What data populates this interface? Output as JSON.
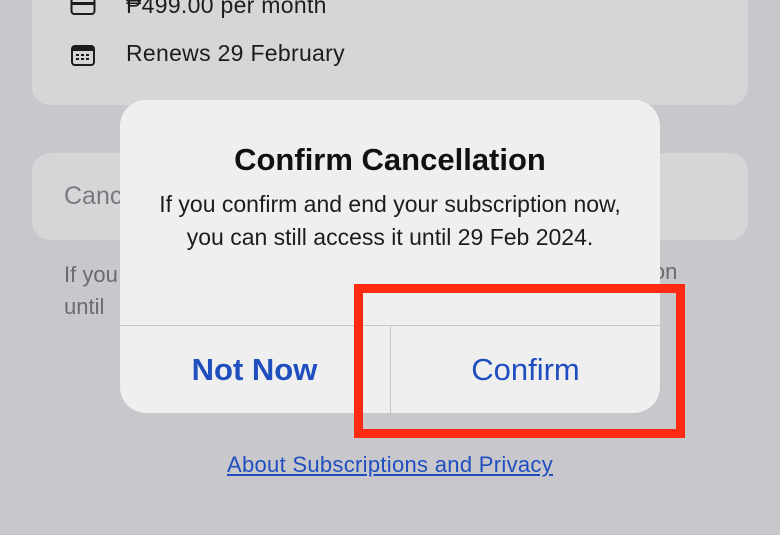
{
  "subscription": {
    "price": "₱499.00 per month",
    "renews": "Renews 29 February",
    "cancel_label": "Canc",
    "note_left_line1": "If you",
    "note_left_line2": "until",
    "note_right": "ion"
  },
  "alert": {
    "title": "Confirm Cancellation",
    "message": "If you confirm and end your subscription now, you can still access it until 29 Feb 2024.",
    "not_now_label": "Not Now",
    "confirm_label": "Confirm"
  },
  "footer": {
    "about_link": "About Subscriptions and Privacy"
  },
  "icons": {
    "price": "credit-card-icon",
    "renew": "calendar-icon"
  },
  "colors": {
    "accent": "#1f4fbf",
    "highlight": "#ff2a12"
  }
}
